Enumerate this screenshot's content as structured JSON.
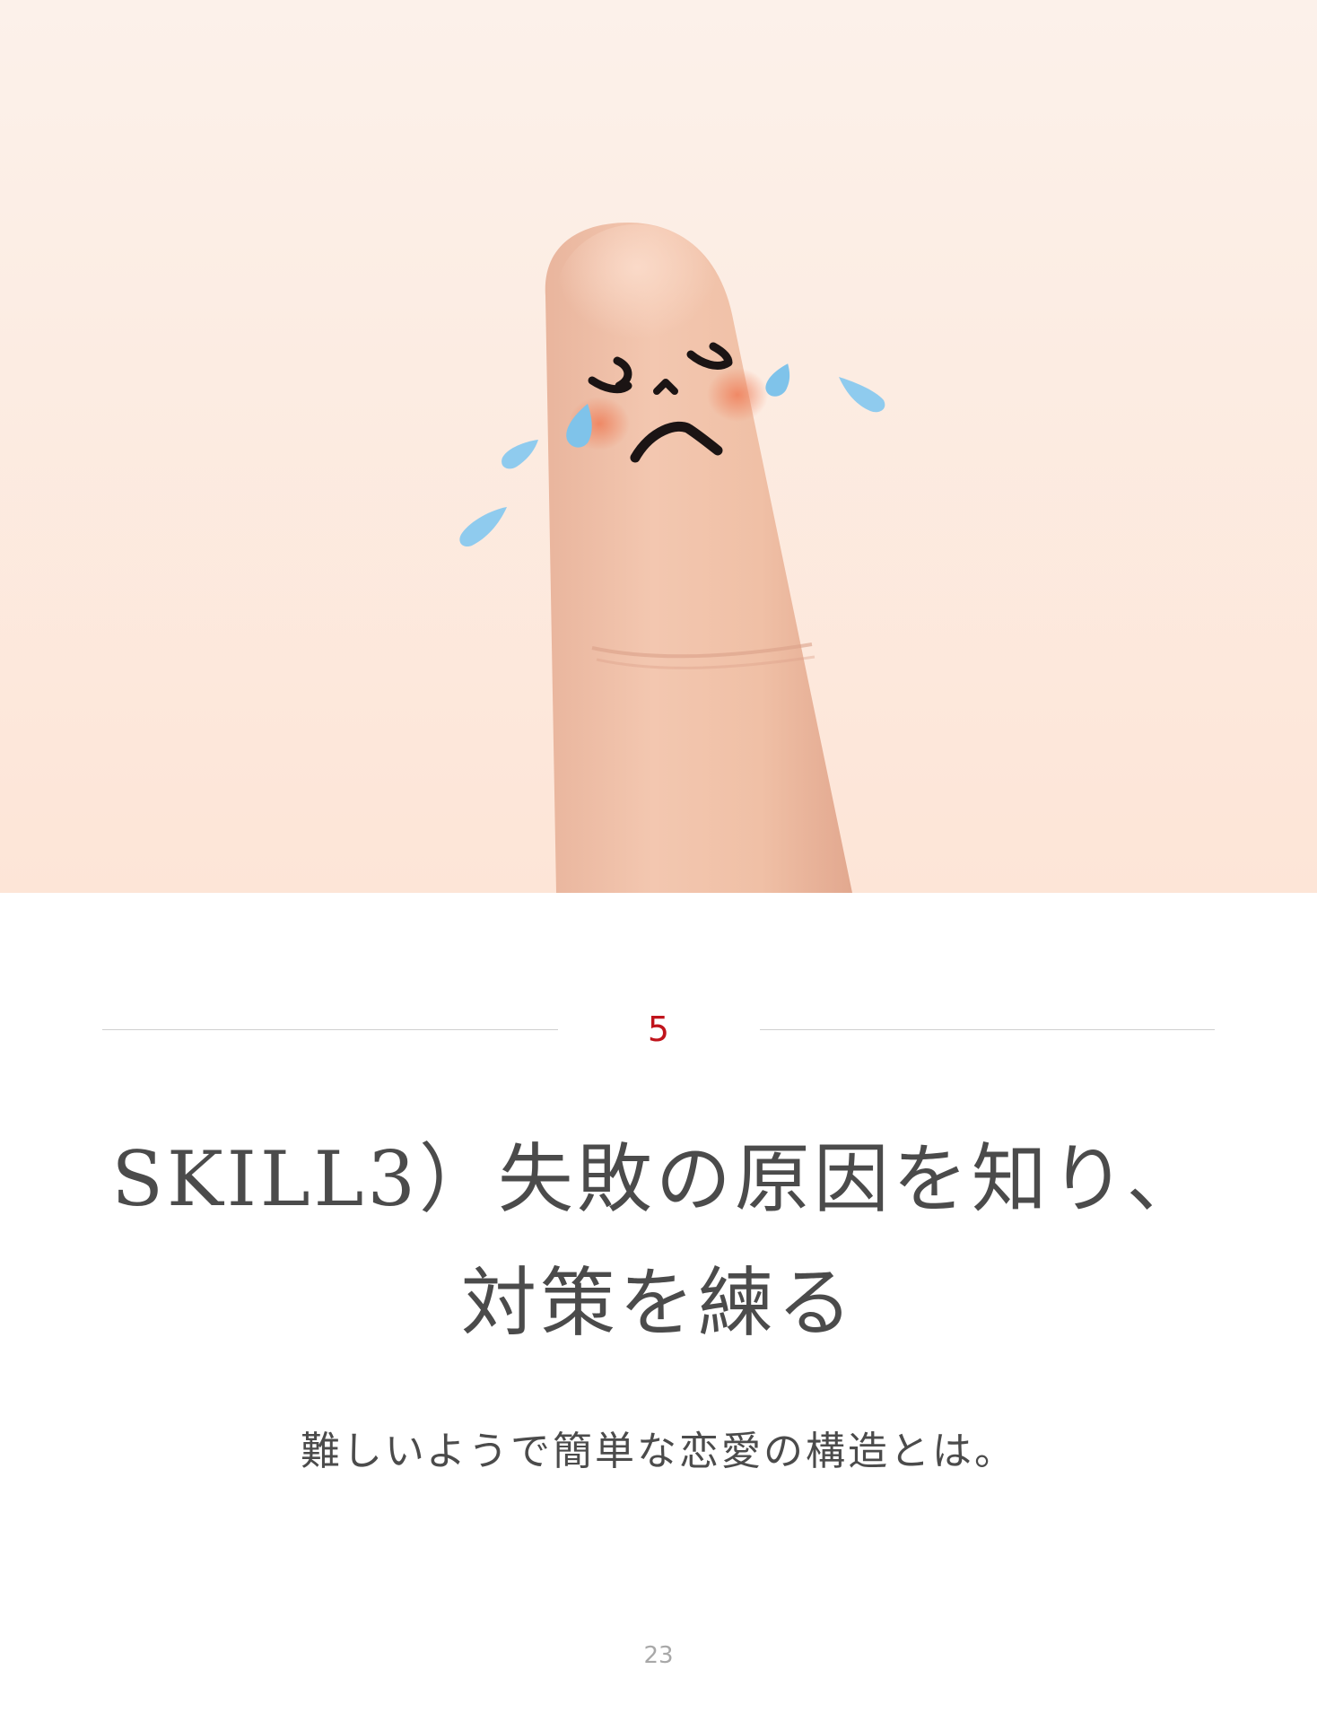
{
  "chapter": {
    "number": "5",
    "accent_color": "#c0141c"
  },
  "title": {
    "line1": "SKILL3）失敗の原因を知り、",
    "line2": "対策を練る"
  },
  "subtitle": "難しいようで簡単な恋愛の構造とは。",
  "page_number": "23",
  "hero": {
    "subject": "crying-finger-face"
  }
}
